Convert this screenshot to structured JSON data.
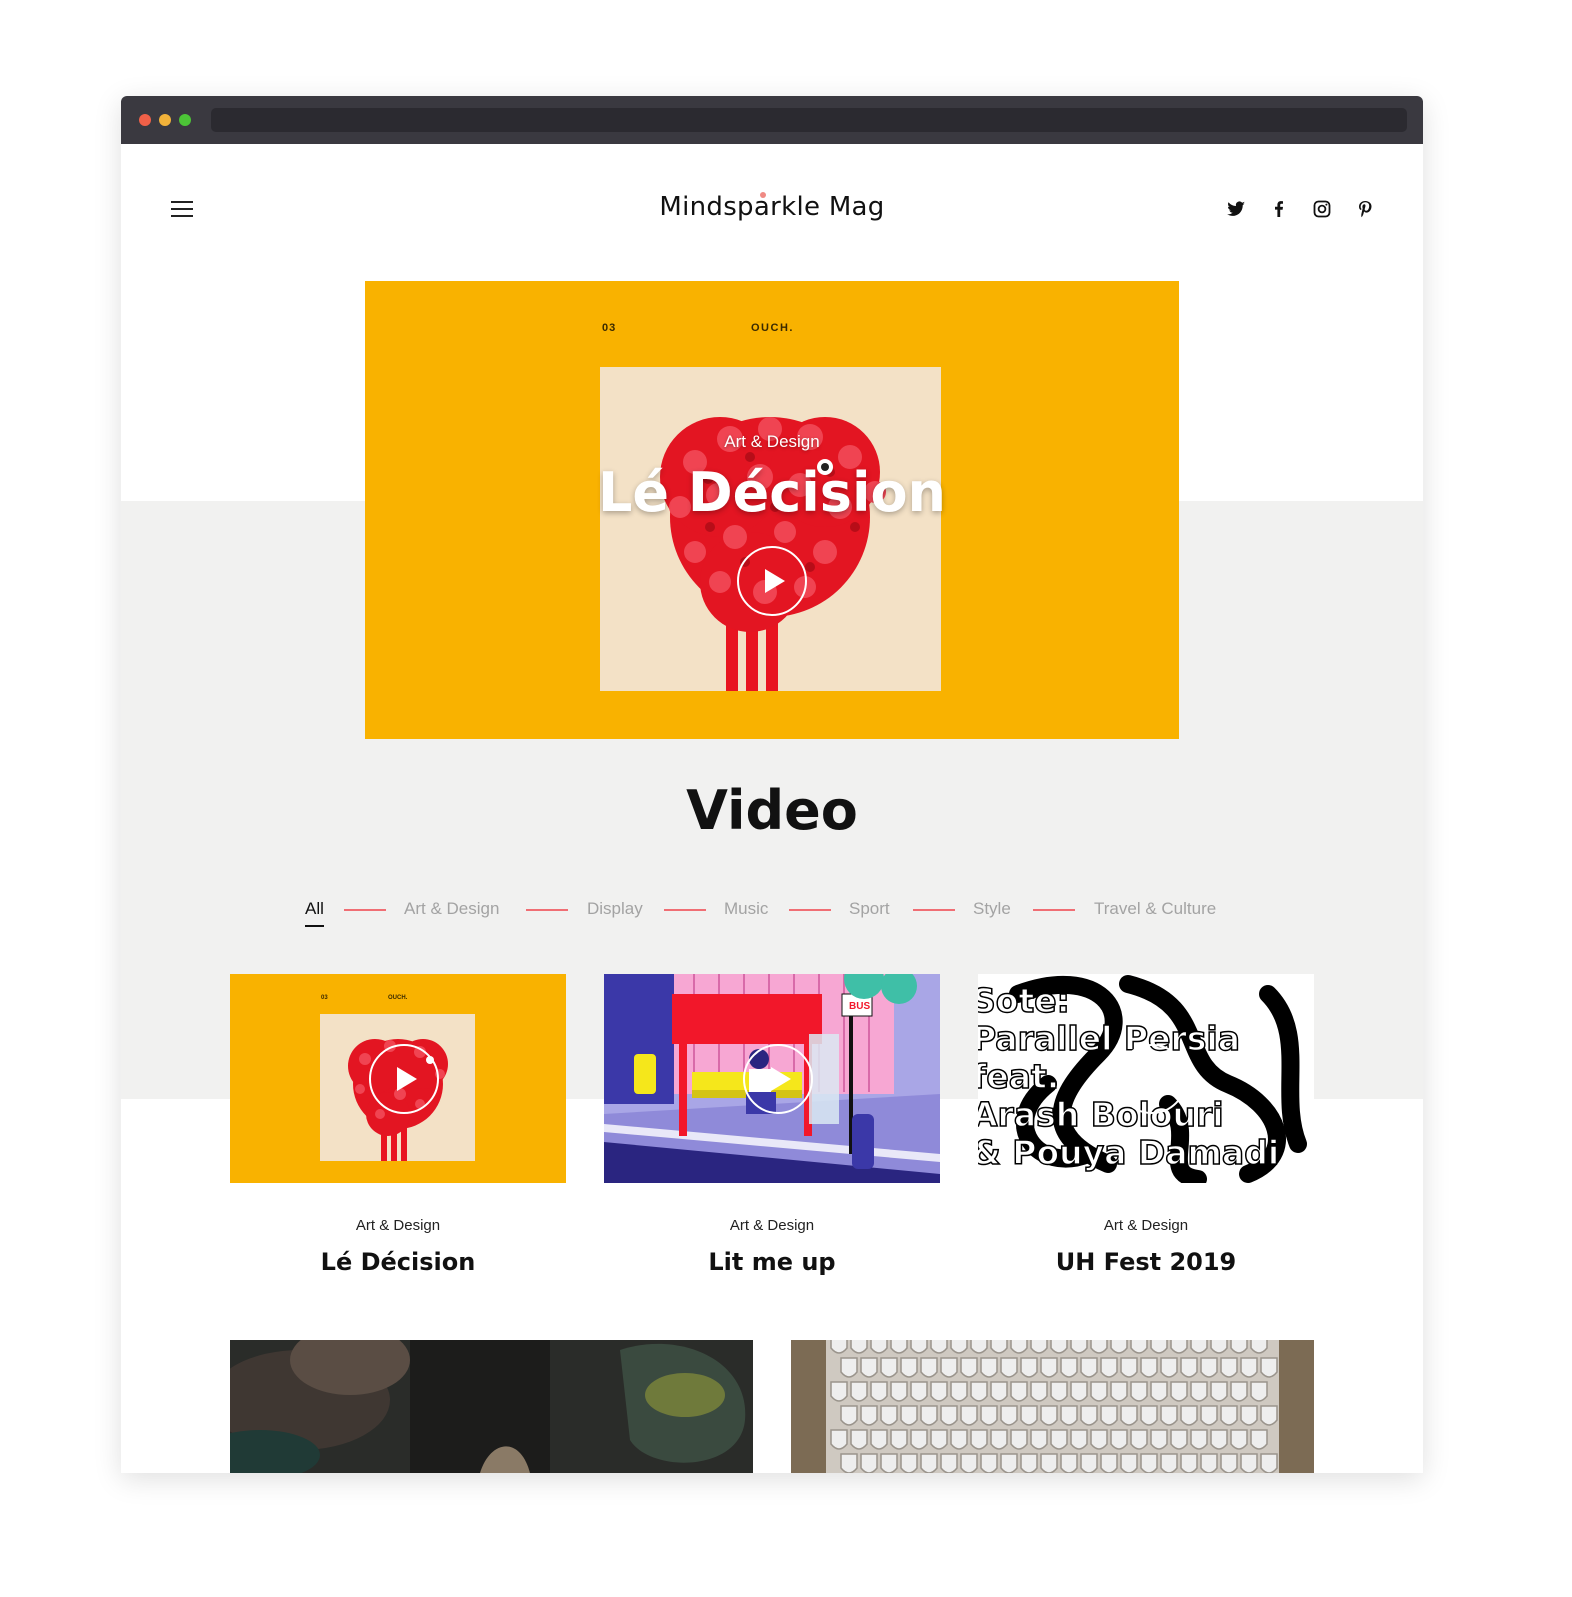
{
  "site": {
    "logo_text": "Mindsparkle Mag",
    "social": [
      "twitter-icon",
      "facebook-icon",
      "instagram-icon",
      "pinterest-icon"
    ]
  },
  "hero": {
    "issue_number": "03",
    "brand": "OUCH.",
    "category": "Art & Design",
    "title": "Lé Décision"
  },
  "section": {
    "title": "Video"
  },
  "filters": [
    {
      "label": "All",
      "active": true
    },
    {
      "label": "Art & Design",
      "active": false
    },
    {
      "label": "Display",
      "active": false
    },
    {
      "label": "Music",
      "active": false
    },
    {
      "label": "Sport",
      "active": false
    },
    {
      "label": "Style",
      "active": false
    },
    {
      "label": "Travel & Culture",
      "active": false
    }
  ],
  "cards": [
    {
      "category": "Art & Design",
      "title": "Lé Décision",
      "thumb_number": "03",
      "thumb_brand": "OUCH."
    },
    {
      "category": "Art & Design",
      "title": "Lit me up",
      "thumb_sign": "BUS"
    },
    {
      "category": "Art & Design",
      "title": "UH Fest 2019",
      "thumb_text": [
        "Sote:",
        "Parallel Persia",
        "feat.",
        "Arash Bolouri",
        "& Pouya Damadi"
      ]
    }
  ],
  "colors": {
    "accent": "#f06e74",
    "hero_bg": "#f9b200",
    "section_bg": "#f1f1f0"
  }
}
